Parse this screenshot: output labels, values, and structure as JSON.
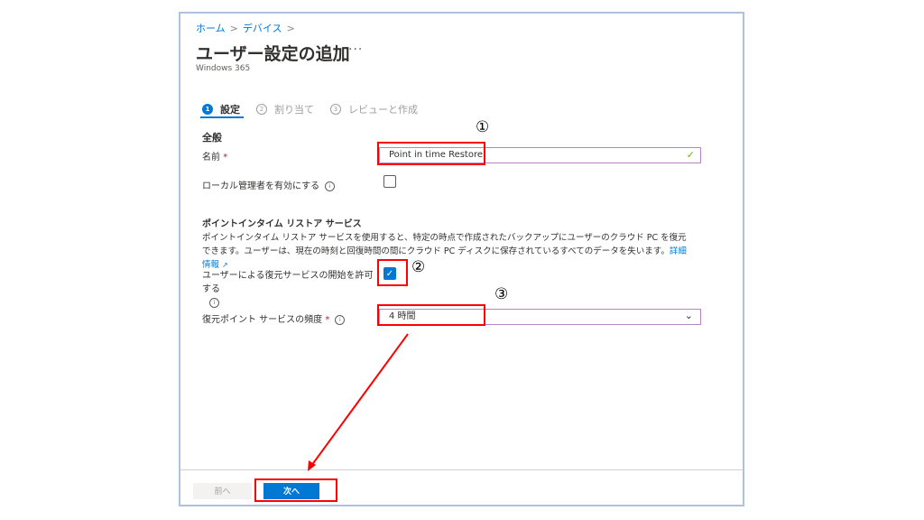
{
  "breadcrumb": [
    "ホーム",
    "デバイス"
  ],
  "page": {
    "title": "ユーザー設定の追加",
    "more_label": "···",
    "subtitle": "Windows 365"
  },
  "steps": [
    {
      "number": "1",
      "label": "設定",
      "active": true
    },
    {
      "number": "2",
      "label": "割り当て",
      "active": false
    },
    {
      "number": "3",
      "label": "レビューと作成",
      "active": false
    }
  ],
  "general": {
    "heading": "全般",
    "name_label": "名前",
    "name_required": "*",
    "name_value": "Point in time Restore",
    "local_admin_label": "ローカル管理者を有効にする",
    "local_admin_checked": false
  },
  "pitr": {
    "heading": "ポイントインタイム リストア サービス",
    "description": "ポイントインタイム リストア サービスを使用すると、特定の時点で作成されたバックアップにユーザーのクラウド PC を復元できます。ユーザーは、現在の時刻と回復時間の間にクラウド PC ディスクに保存されているすべてのデータを失います。",
    "learn_more": "詳細情報",
    "allow_label": "ユーザーによる復元サービスの開始を許可する",
    "allow_checked": true,
    "frequency_label": "復元ポイント サービスの頻度",
    "frequency_required": "*",
    "frequency_value": "4 時間"
  },
  "footer": {
    "prev_label": "前へ",
    "next_label": "次へ"
  },
  "annotations": {
    "one": "①",
    "two": "②",
    "three": "③",
    "color": "#ff0000"
  },
  "icons": {
    "chevron_right": "›",
    "info": "i",
    "checkmark": "✓",
    "chevron_down": "⌄",
    "external_link": "↗"
  }
}
